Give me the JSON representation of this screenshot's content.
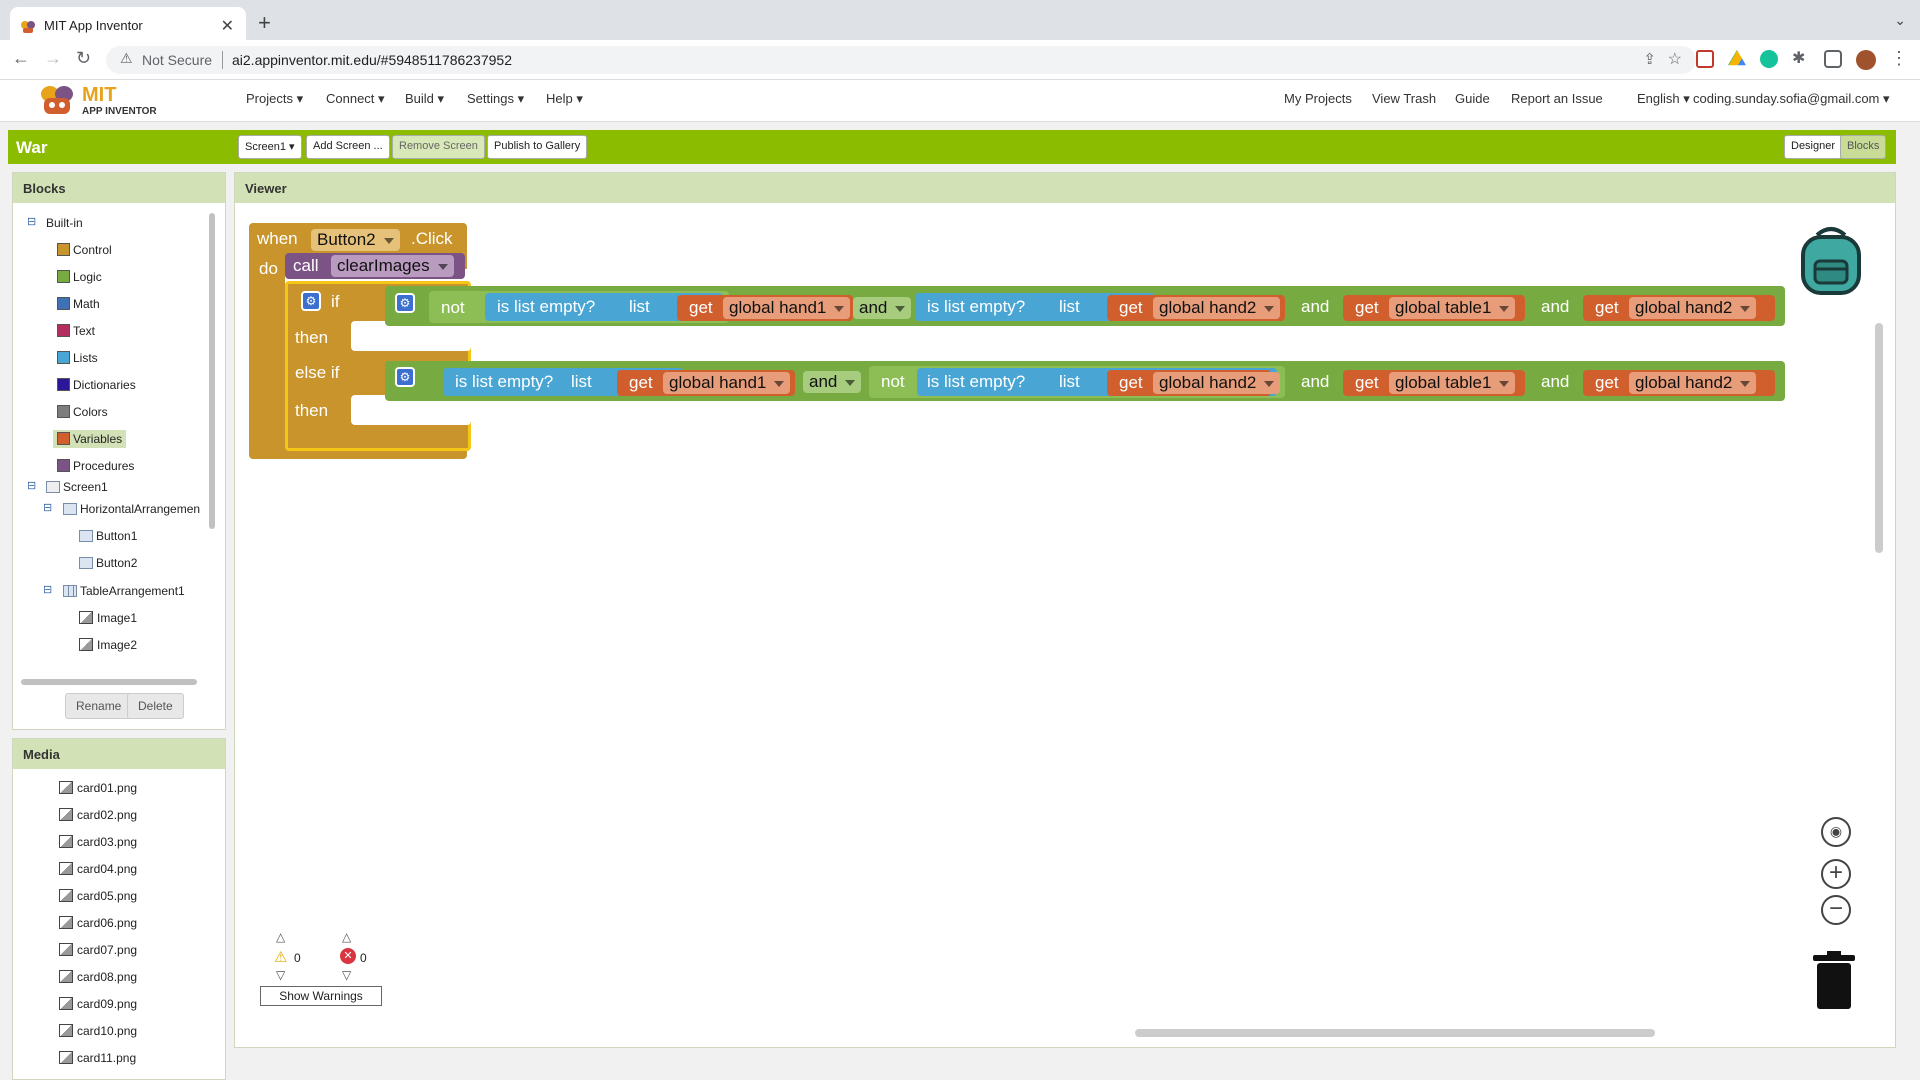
{
  "browser": {
    "tab_title": "MIT App Inventor",
    "new_tab": "+",
    "not_secure": "Not Secure",
    "url": "ai2.appinventor.mit.edu/#5948511786237952"
  },
  "app": {
    "logo_mit": "MIT",
    "logo_sub": "APP INVENTOR",
    "menus": [
      "Projects",
      "Connect",
      "Build",
      "Settings",
      "Help"
    ],
    "right_links": [
      "My Projects",
      "View Trash",
      "Guide",
      "Report an Issue",
      "English",
      "coding.sunday.sofia@gmail.com"
    ]
  },
  "project": {
    "name": "War",
    "screen_select": "Screen1",
    "add_screen": "Add Screen ...",
    "remove_screen": "Remove Screen",
    "publish": "Publish to Gallery",
    "designer": "Designer",
    "blocks": "Blocks"
  },
  "blocks_panel": {
    "title": "Blocks",
    "builtin": "Built-in",
    "builtin_items": [
      {
        "label": "Control",
        "color": "#c8942b"
      },
      {
        "label": "Logic",
        "color": "#77ab41"
      },
      {
        "label": "Math",
        "color": "#3f71b5"
      },
      {
        "label": "Text",
        "color": "#b32d5e"
      },
      {
        "label": "Lists",
        "color": "#49a6d4"
      },
      {
        "label": "Dictionaries",
        "color": "#2d1799"
      },
      {
        "label": "Colors",
        "color": "#7d7d7d"
      },
      {
        "label": "Variables",
        "color": "#d05f2d"
      },
      {
        "label": "Procedures",
        "color": "#7c5385"
      }
    ],
    "screen": "Screen1",
    "components": [
      "HorizontalArrangemen",
      "Button1",
      "Button2",
      "TableArrangement1",
      "Image1",
      "Image2"
    ],
    "rename": "Rename",
    "delete": "Delete"
  },
  "media_panel": {
    "title": "Media",
    "files": [
      "card01.png",
      "card02.png",
      "card03.png",
      "card04.png",
      "card05.png",
      "card06.png",
      "card07.png",
      "card08.png",
      "card09.png",
      "card10.png",
      "card11.png"
    ]
  },
  "viewer": {
    "title": "Viewer",
    "when": "when",
    "component": "Button2",
    "event": ".Click",
    "do": "do",
    "call": "call",
    "procedure": "clearImages",
    "if": "if",
    "then": "then",
    "else_if": "else if",
    "not": "not",
    "is_list_empty": "is list empty?",
    "list": "list",
    "and": "and",
    "get": "get",
    "var_hand1": "global hand1",
    "var_hand2": "global hand2",
    "var_table1": "global table1",
    "warnings_count": "0",
    "errors_count": "0",
    "show_warnings": "Show Warnings"
  }
}
